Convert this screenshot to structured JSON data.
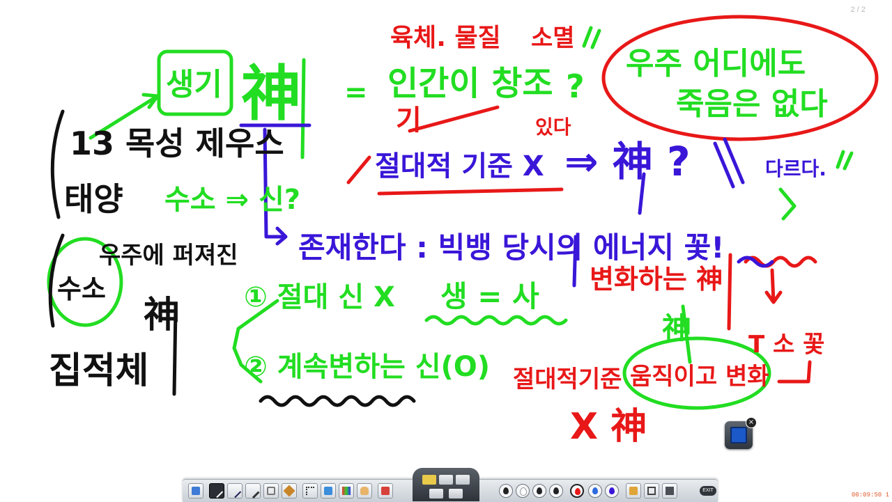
{
  "page_counter": "2 / 2",
  "timer": "00:09:50 1",
  "board": {
    "notes": {
      "saengi": "생기",
      "shin_big": "神",
      "equals": "=",
      "human_created": "인간이 창조",
      "question1": "?",
      "yukche_muljil": "육체. 물질",
      "sonyeol": "소멸",
      "gi": "기",
      "universe_line1": "우주 어디에도",
      "universe_line2": "죽음은 없다",
      "jeoldaejeok": "절대적 기준 X",
      "itda": "있다",
      "arrow_shin": "⇒ 神 ?",
      "dareuda": "다르다.",
      "star_zeus": "13 목성 제우스",
      "taeyang": "태양",
      "suso_shin": "수소 ⇒ 신?",
      "jonjae": "존재한다 : 빅뱅 당시의 에너지 꽃!",
      "scattered": "우주에 퍼져진",
      "suso_circled": "수소",
      "shin_left": "神",
      "jipjeokche": "집적체",
      "item1": "① 절대 신 X",
      "saeng_sa": "생 = 사",
      "item2": "② 계속변하는 신(O)",
      "byeonhwa_shin": "변화하는 神",
      "shin_small": "神",
      "abs_gijun": "절대적기준",
      "umjigigo": "움직이고 변화",
      "x_shin": "X 神",
      "flower_symbols": "T 소 꽃"
    }
  },
  "colors": {
    "green": "#22dd22",
    "red": "#e81818",
    "blue": "#3a16d8",
    "black": "#111111"
  },
  "toolbar": {
    "exit_label": "EXIT",
    "tools": [
      "board-icon",
      "pen-black-icon",
      "pen-thin-icon",
      "brush-icon",
      "eraser-icon",
      "highlighter-icon",
      "pointer-icon",
      "screen-icon",
      "image-icon",
      "hand-icon",
      "tools-icon"
    ],
    "colors": [
      "black",
      "white",
      "black",
      "black",
      "red",
      "blue",
      "blue",
      "orange"
    ]
  },
  "widget": {
    "close_label": "×"
  }
}
